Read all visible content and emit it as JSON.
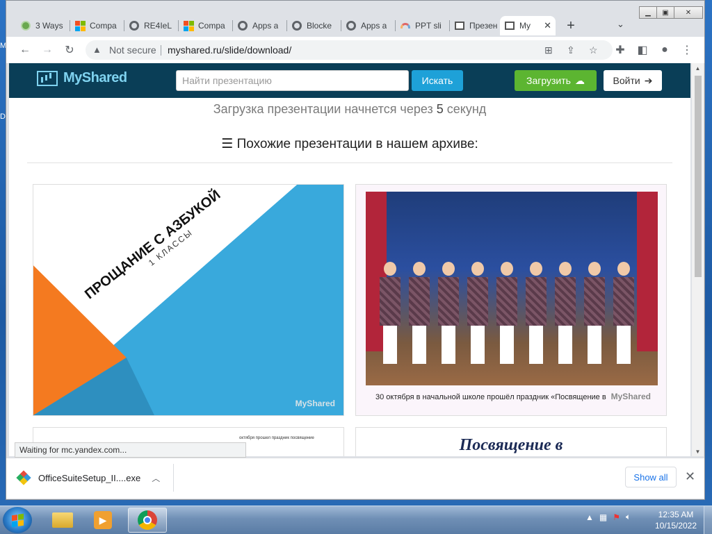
{
  "desktop": {
    "edge_letters": [
      "M",
      "D"
    ]
  },
  "browser": {
    "tabs": [
      {
        "title": "3 Ways",
        "icon": "green-circle-icon"
      },
      {
        "title": "Compa",
        "icon": "microsoft-icon"
      },
      {
        "title": "RE4IeL",
        "icon": "globe-icon"
      },
      {
        "title": "Compa",
        "icon": "microsoft-icon"
      },
      {
        "title": "Apps a",
        "icon": "globe-icon"
      },
      {
        "title": "Blocke",
        "icon": "globe-icon"
      },
      {
        "title": "Apps a",
        "icon": "globe-icon"
      },
      {
        "title": "PPT sli",
        "icon": "rainbow-icon"
      },
      {
        "title": "Презен",
        "icon": "presentation-icon"
      },
      {
        "title": "My",
        "icon": "presentation-icon",
        "active": true
      }
    ],
    "new_tab_glyph": "+",
    "security_label": "Not secure",
    "url": "myshared.ru/slide/download/",
    "status_text": "Waiting for mc.yandex.com..."
  },
  "site": {
    "logo_text": "MyShared",
    "search_placeholder": "Найти презентацию",
    "search_button": "Искать",
    "upload_button": "Загрузить",
    "login_button": "Войти",
    "countdown": {
      "prefix": "Загрузка презентации начнется через",
      "seconds": "5",
      "suffix": "секунд"
    },
    "similar_heading": "Похожие презентации в нашем архиве:",
    "cards": [
      {
        "title": "ПРОЩАНИЕ С АЗБУКОЙ",
        "subtitle": "1 КЛАССЫ",
        "watermark": "MyShared"
      },
      {
        "caption": "30 октября в начальной школе прошёл праздник «Посвящение в",
        "watermark": "MyShared"
      },
      {
        "snippet": "октября прошел праздник посвящение"
      },
      {
        "title": "Посвящение в"
      }
    ]
  },
  "downloads": {
    "file_name": "OfficeSuiteSetup_II....exe",
    "show_all": "Show all"
  },
  "taskbar": {
    "time": "12:35 AM",
    "date": "10/15/2022"
  }
}
